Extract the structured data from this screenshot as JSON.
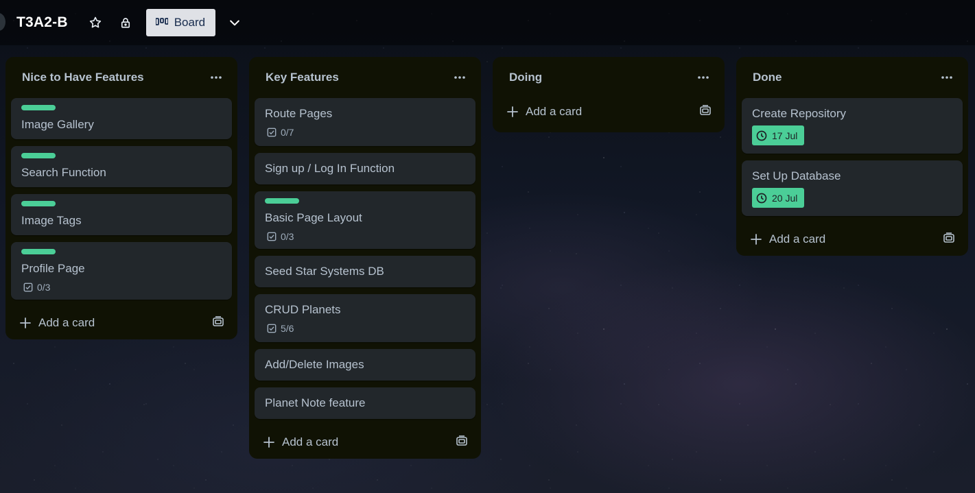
{
  "board": {
    "title": "T3A2-B",
    "view_label": "Board",
    "icons": {
      "star": "star-icon",
      "lock": "lock-icon",
      "board": "board-icon",
      "chevron": "chevron-down-icon"
    }
  },
  "colors": {
    "label_green": "#4bce97",
    "list_bg": "#101204",
    "card_bg": "#22272b"
  },
  "lists": [
    {
      "title": "Nice to Have Features",
      "add_label": "Add a card",
      "cards": [
        {
          "title": "Image Gallery",
          "label": true
        },
        {
          "title": "Search Function",
          "label": true
        },
        {
          "title": "Image Tags",
          "label": true
        },
        {
          "title": "Profile Page",
          "label": true,
          "checklist": "0/3"
        }
      ]
    },
    {
      "title": "Key Features",
      "add_label": "Add a card",
      "cards": [
        {
          "title": "Route Pages",
          "checklist": "0/7"
        },
        {
          "title": "Sign up / Log In Function"
        },
        {
          "title": "Basic Page Layout",
          "label": true,
          "checklist": "0/3"
        },
        {
          "title": "Seed Star Systems DB"
        },
        {
          "title": "CRUD Planets",
          "checklist": "5/6"
        },
        {
          "title": "Add/Delete Images"
        },
        {
          "title": "Planet Note feature"
        }
      ]
    },
    {
      "title": "Doing",
      "add_label": "Add a card",
      "cards": []
    },
    {
      "title": "Done",
      "add_label": "Add a card",
      "cards": [
        {
          "title": "Create Repository",
          "due": "17 Jul"
        },
        {
          "title": "Set Up Database",
          "due": "20 Jul"
        }
      ]
    }
  ]
}
